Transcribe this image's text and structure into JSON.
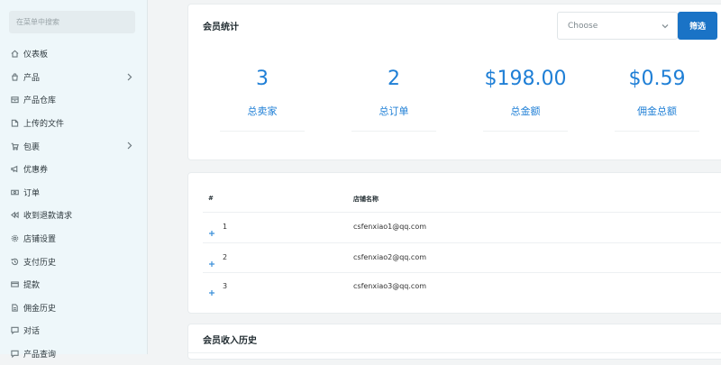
{
  "sidebar": {
    "search_placeholder": "在菜单中搜索",
    "items": [
      {
        "label": "仪表板",
        "icon": "home-icon",
        "has_submenu": false
      },
      {
        "label": "产品",
        "icon": "shopping-bag-icon",
        "has_submenu": true
      },
      {
        "label": "产品仓库",
        "icon": "archive-icon",
        "has_submenu": false
      },
      {
        "label": "上传的文件",
        "icon": "folder-icon",
        "has_submenu": false
      },
      {
        "label": "包裹",
        "icon": "cart-icon",
        "has_submenu": true
      },
      {
        "label": "优惠券",
        "icon": "megaphone-icon",
        "has_submenu": false
      },
      {
        "label": "订单",
        "icon": "money-icon",
        "has_submenu": false
      },
      {
        "label": "收到退款请求",
        "icon": "backward-icon",
        "has_submenu": false
      },
      {
        "label": "店铺设置",
        "icon": "cog-icon",
        "has_submenu": false
      },
      {
        "label": "支付历史",
        "icon": "history-icon",
        "has_submenu": false
      },
      {
        "label": "提款",
        "icon": "card-icon",
        "has_submenu": false
      },
      {
        "label": "佣金历史",
        "icon": "file-icon",
        "has_submenu": false
      },
      {
        "label": "对话",
        "icon": "chat-icon",
        "has_submenu": false
      },
      {
        "label": "产品查询",
        "icon": "chat-icon",
        "has_submenu": false
      }
    ]
  },
  "stats_card": {
    "title": "会员统计",
    "select_value": "Choose",
    "filter_label": "筛选",
    "stats": [
      {
        "value": "3",
        "label": "总卖家"
      },
      {
        "value": "2",
        "label": "总订单"
      },
      {
        "value": "$198.00",
        "label": "总金额"
      },
      {
        "value": "$0.59",
        "label": "佣金总额"
      }
    ]
  },
  "table_card": {
    "headers": [
      "#",
      "店铺名称"
    ],
    "rows": [
      {
        "num": "1",
        "email": "csfenxiao1@qq.com"
      },
      {
        "num": "2",
        "email": "csfenxiao2@qq.com"
      },
      {
        "num": "3",
        "email": "csfenxiao3@qq.com"
      }
    ]
  },
  "income_card": {
    "title": "会员收入历史"
  },
  "colors": {
    "accent": "#1f7fd6",
    "button": "#1a73c6",
    "sidebar_bg": "#eef7fa"
  }
}
